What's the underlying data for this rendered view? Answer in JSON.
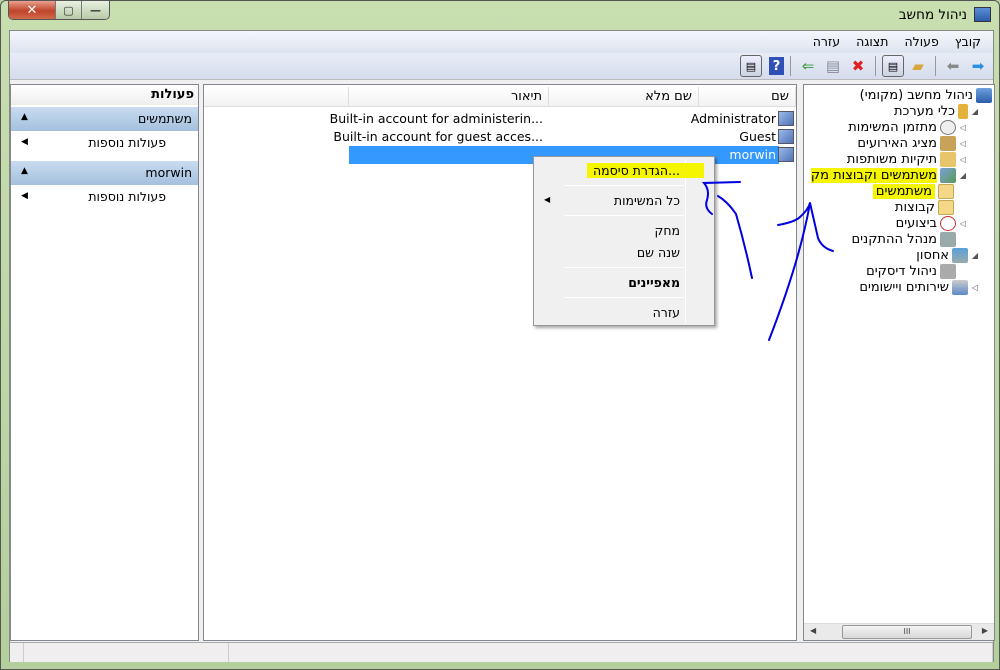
{
  "window": {
    "title": "ניהול מחשב",
    "close": "✕",
    "maximize": "▢",
    "minimize": "—"
  },
  "menu": [
    "קובץ",
    "פעולה",
    "תצוגה",
    "עזרה"
  ],
  "toolbar": [
    "back-icon",
    "forward-icon",
    "up-folder-icon",
    "show-hide-tree-icon",
    "delete-icon",
    "properties-icon",
    "export-list-icon",
    "help-icon",
    "show-hide-action-pane-icon"
  ],
  "tree": {
    "root": "ניהול מחשב (מקומי)",
    "items": [
      {
        "label": "כלי מערכת"
      },
      {
        "label": "מתזמן המשימות"
      },
      {
        "label": "מציג האירועים"
      },
      {
        "label": "תיקיות משותפות"
      },
      {
        "label": "משתמשים וקבוצות מק"
      },
      {
        "label": "משתמשים"
      },
      {
        "label": "קבוצות"
      },
      {
        "label": "ביצועים"
      },
      {
        "label": "מנהל ההתקנים"
      },
      {
        "label": "אחסון"
      },
      {
        "label": "ניהול דיסקים"
      },
      {
        "label": "שירותים ויישומים"
      }
    ],
    "scroll_thumb": "III"
  },
  "list": {
    "columns": [
      "שם",
      "שם מלא",
      "תיאור"
    ],
    "rows": [
      {
        "name": "Administrator",
        "full_name": "",
        "description": "Built-in account for administerin..."
      },
      {
        "name": "Guest",
        "full_name": "",
        "description": "Built-in account for guest acces..."
      },
      {
        "name": "morwin",
        "full_name": "",
        "description": ""
      }
    ]
  },
  "context_menu": {
    "items": [
      "הגדרת סיסמה...",
      "כל המשימות",
      "מחק",
      "שנה שם",
      "מאפיינים",
      "עזרה"
    ]
  },
  "actions": {
    "title": "פעולות",
    "groups": [
      {
        "label": "משתמשים",
        "item": "פעולות נוספות"
      },
      {
        "label": "morwin",
        "item": "פעולות נוספות"
      }
    ]
  },
  "colors": {
    "selection": "#3399ff",
    "highlighter": "#f5f500",
    "ink": "#0000e0"
  }
}
